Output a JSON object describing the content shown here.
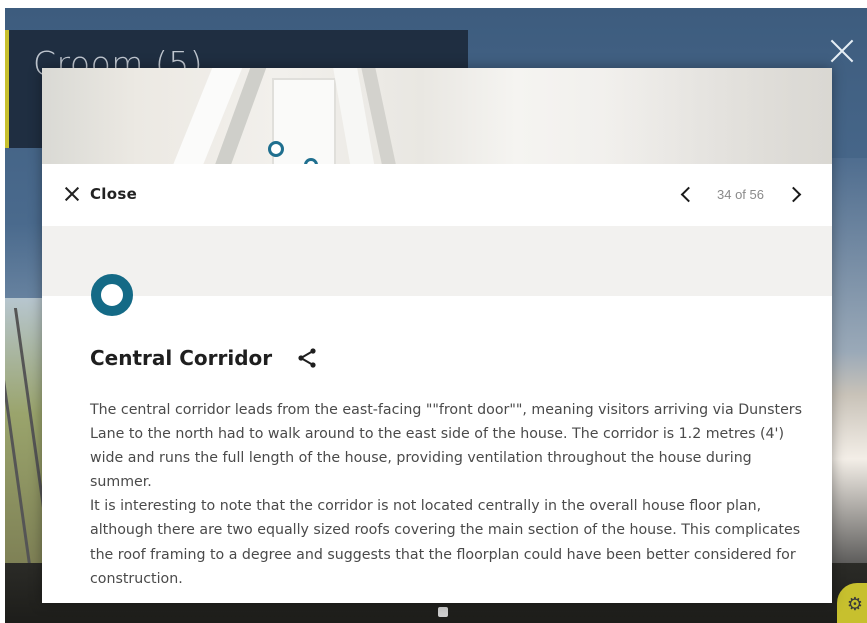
{
  "scene": {
    "room_title": "Croom (5)"
  },
  "modal": {
    "close_label": "Close",
    "pager": {
      "current": 34,
      "total": 56,
      "text": "34 of 56"
    },
    "marker_color": "#146a86",
    "title": "Central Corridor",
    "paragraphs": [
      "The central corridor leads from the east-facing \"\"front door\"\", meaning visitors arriving via Dunsters Lane to the north had to walk around to the east side of the house. The corridor is 1.2 metres (4') wide and runs the full length of the house, providing ventilation throughout the house during summer.",
      "It is interesting to note that the corridor is not located centrally in the overall house floor plan, although there are two equally sized roofs covering the main section of the house. This complicates the roof framing to a degree and suggests that the floorplan could have been better considered for construction."
    ]
  },
  "icons": {
    "close": "close-icon",
    "prev": "chevron-left-icon",
    "next": "chevron-right-icon",
    "share": "share-icon",
    "marker": "location-marker-icon",
    "settings": "gear-icon"
  }
}
